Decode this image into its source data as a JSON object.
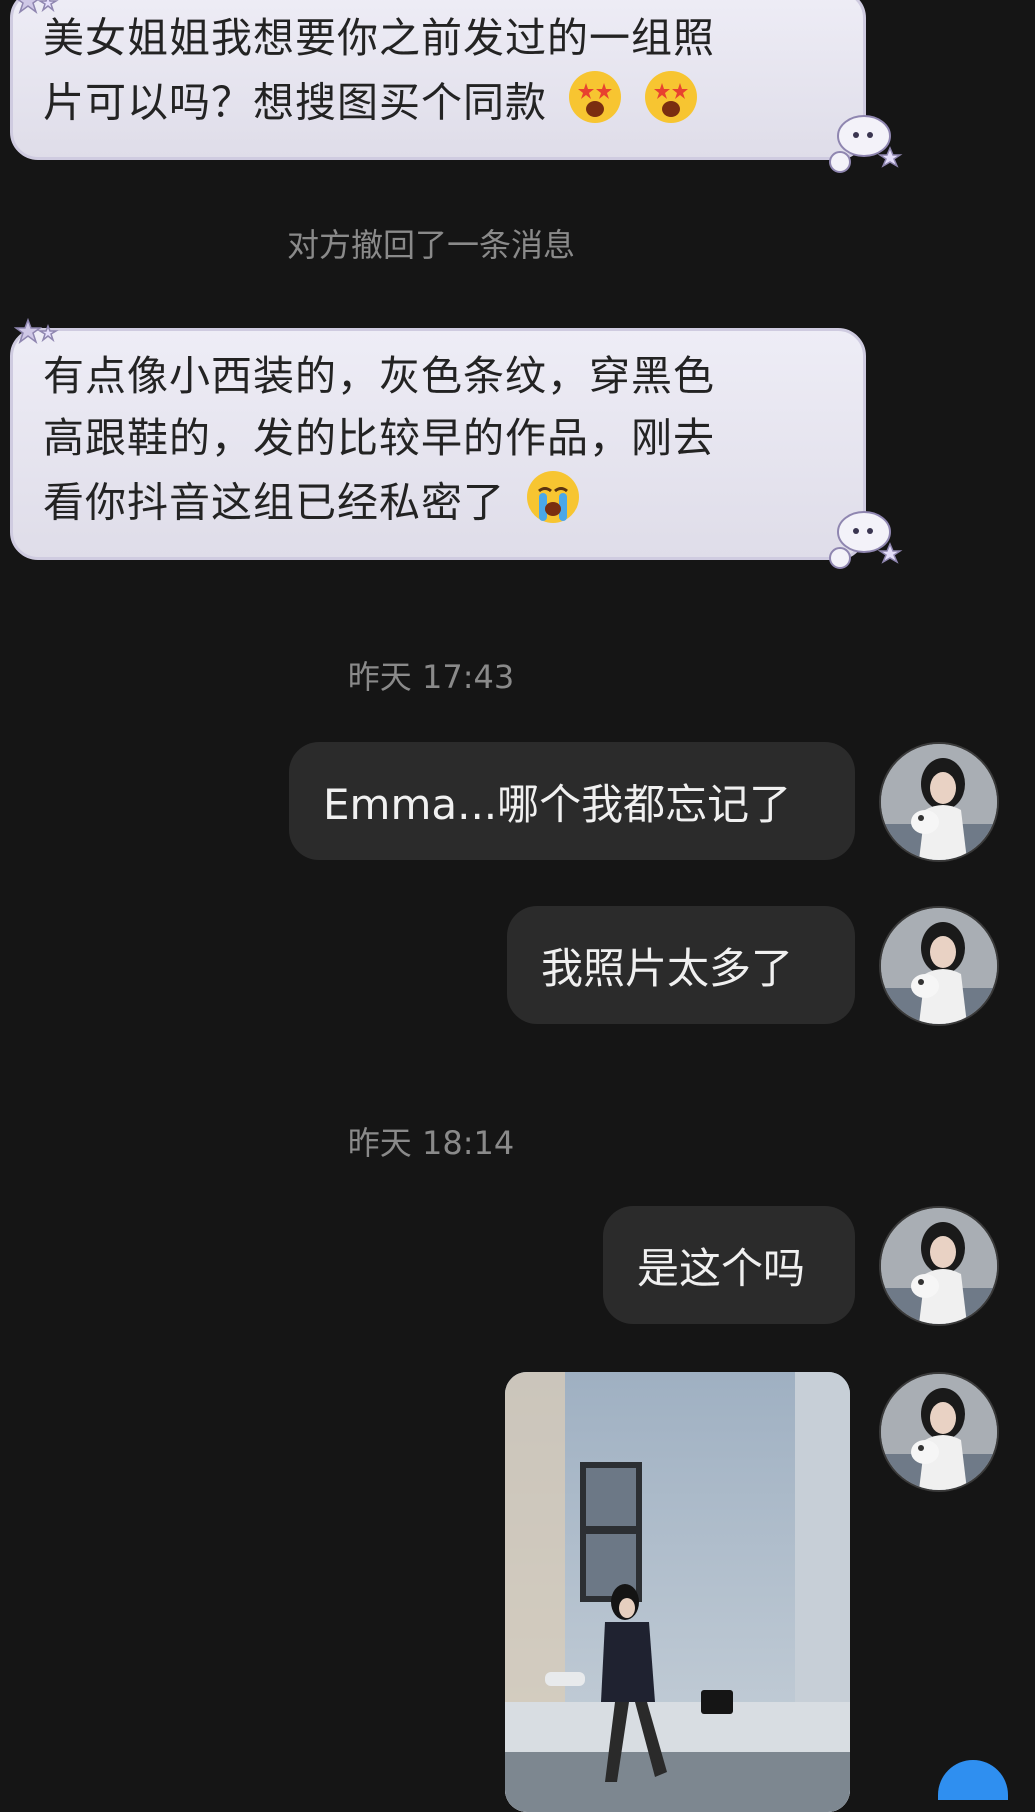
{
  "colors": {
    "background": "#151515",
    "incoming_bubble": "#e6e4ef",
    "outgoing_bubble": "#2b2b2b",
    "system_text": "#8a8a8a"
  },
  "messages_in": [
    {
      "line1": "美女姐姐我想要你之前发过的一组照",
      "line2": "片可以吗？想搜图买个同款",
      "emojis": [
        "star-struck-emoji",
        "star-struck-emoji"
      ]
    },
    {
      "line1": "有点像小西装的，灰色条纹，穿黑色",
      "line2": "高跟鞋的，发的比较早的作品，刚去",
      "line3": "看你抖音这组已经私密了",
      "emojis": [
        "crying-emoji"
      ]
    }
  ],
  "system": {
    "recalled": "对方撤回了一条消息",
    "time1": "昨天 17:43",
    "time2": "昨天 18:14"
  },
  "messages_out": [
    {
      "text": "Emma...哪个我都忘记了"
    },
    {
      "text": "我照片太多了"
    },
    {
      "text": "是这个吗"
    },
    {
      "type": "image",
      "icon": "photo-image"
    }
  ]
}
